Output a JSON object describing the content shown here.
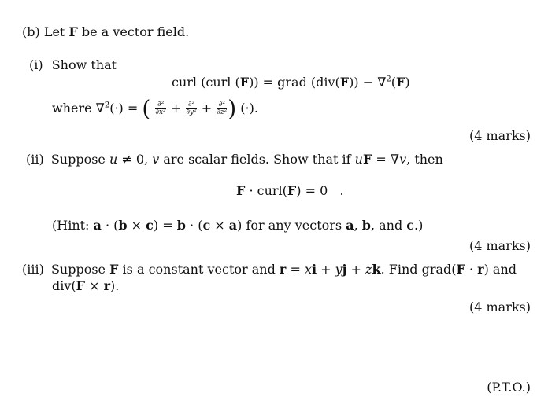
{
  "part_b": {
    "label": "(b)",
    "intro_pre": "Let ",
    "intro_F": "F",
    "intro_post": " be a vector field."
  },
  "part_i": {
    "label": "(i)",
    "text": "Show that",
    "equation": {
      "lhs_1": "curl (curl (",
      "F1": "F",
      "lhs_2": ")) = grad (div(",
      "F2": "F",
      "rhs_1": ")) − ∇",
      "sq": "2",
      "rhs_2": "(",
      "F3": "F",
      "rhs_3": ")"
    },
    "where": {
      "pre": "where ∇",
      "sq": "2",
      "op": "(·) = ",
      "open": "(",
      "num": "∂²",
      "den_x": "∂x²",
      "den_y": "∂y²",
      "den_z": "∂z²",
      "plus": " + ",
      "close": ")",
      "post": " (·)."
    },
    "marks": "(4 marks)"
  },
  "part_ii": {
    "label": "(ii)",
    "text_1": "Suppose ",
    "u": "u",
    "text_2": " ≠ 0, ",
    "v": "v",
    "text_3": " are scalar fields. Show that if ",
    "u2": "u",
    "F": "F",
    "text_4": " = ∇",
    "v2": "v",
    "text_5": ", then",
    "equation": {
      "F": "F",
      "rest": " · curl(",
      "F2": "F",
      "end": ") = 0   ."
    },
    "hint": {
      "pre": "(Hint: ",
      "a": "a",
      "t1": " · (",
      "b": "b",
      "t2": " × ",
      "c": "c",
      "t3": ") = ",
      "b2": "b",
      "t4": " · (",
      "c2": "c",
      "t5": " × ",
      "a2": "a",
      "t6": ") for any vectors ",
      "a3": "a",
      "t7": ", ",
      "b3": "b",
      "t8": ", and ",
      "c3": "c",
      "t9": ".)"
    },
    "marks": "(4 marks)"
  },
  "part_iii": {
    "label": "(iii)",
    "t1": "Suppose ",
    "F": "F",
    "t2": " is a constant vector and ",
    "r": "r",
    "t3": " = ",
    "x": "x",
    "i": "i",
    "t4": " + ",
    "y": "y",
    "j": "j",
    "t5": " + ",
    "z": "z",
    "k": "k",
    "t6": ".  Find grad(",
    "F2": "F",
    "t7": " · ",
    "r2": "r",
    "t8": ") and",
    "line2_pre": "div(",
    "F3": "F",
    "line2_mid": " × ",
    "r3": "r",
    "line2_end": ").",
    "marks": "(4 marks)"
  },
  "footer": {
    "pto": "(P.T.O.)"
  }
}
